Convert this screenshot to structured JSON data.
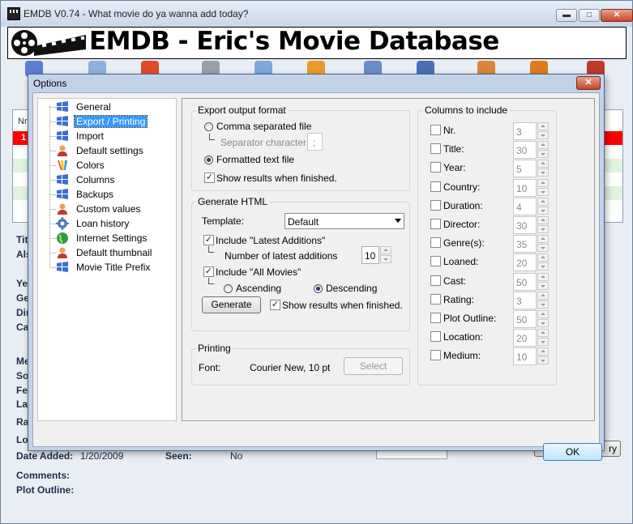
{
  "main_window": {
    "title": "EMDB V0.74 - What movie do ya wanna add today?",
    "banner_title": "EMDB - Eric's Movie Database",
    "controls": {
      "minimize": "▬",
      "maximize": "□",
      "close": "✕"
    }
  },
  "background_details": {
    "list_header_fragment": "Nr",
    "row_fragment": "1",
    "labels": [
      "Tit",
      "Als",
      "Ye",
      "Ge",
      "Dir",
      "Ca",
      "Me",
      "So",
      "Fe",
      "La",
      "Ra",
      "Lo"
    ],
    "date_added_label": "Date Added:",
    "date_added_value": "1/20/2009",
    "seen_label": "Seen:",
    "seen_value": "No",
    "comments_label": "Comments:",
    "plot_outline_label": "Plot Outline:",
    "button_fragment": "ry"
  },
  "dialog": {
    "title": "Options",
    "close": "✕",
    "ok_label": "OK",
    "tree": [
      {
        "label": "General",
        "icon": "windows-flag-icon"
      },
      {
        "label": "Export / Printing",
        "icon": "windows-flag-icon",
        "selected": true
      },
      {
        "label": "Import",
        "icon": "windows-flag-icon"
      },
      {
        "label": "Default settings",
        "icon": "user-icon"
      },
      {
        "label": "Colors",
        "icon": "palette-icon"
      },
      {
        "label": "Columns",
        "icon": "windows-flag-icon"
      },
      {
        "label": "Backups",
        "icon": "windows-flag-icon"
      },
      {
        "label": "Custom values",
        "icon": "user-icon"
      },
      {
        "label": "Loan history",
        "icon": "gear-icon"
      },
      {
        "label": "Internet Settings",
        "icon": "globe-icon"
      },
      {
        "label": "Default thumbnail",
        "icon": "user-icon"
      },
      {
        "label": "Movie Title Prefix",
        "icon": "windows-flag-icon"
      }
    ],
    "export": {
      "title": "Export output format",
      "csv_label": "Comma separated file",
      "csv_selected": false,
      "separator_label": "Separator character:",
      "separator_value": ";",
      "formatted_label": "Formatted text file",
      "formatted_selected": true,
      "show_results_label": "Show results when finished.",
      "show_results_checked": true
    },
    "html": {
      "title": "Generate HTML",
      "template_label": "Template:",
      "template_value": "Default",
      "latest_label": "Include \"Latest Additions\"",
      "latest_checked": true,
      "number_label": "Number of latest additions",
      "number_value": "10",
      "all_label": "Include \"All Movies\"",
      "all_checked": true,
      "ascending_label": "Ascending",
      "ascending_selected": false,
      "descending_label": "Descending",
      "descending_selected": true,
      "generate_label": "Generate",
      "show_results_label": "Show results when finished.",
      "show_results_checked": true
    },
    "printing": {
      "title": "Printing",
      "font_label": "Font:",
      "font_value": "Courier New, 10 pt",
      "select_label": "Select"
    },
    "columns": {
      "title": "Columns to include",
      "items": [
        {
          "label": "Nr.",
          "value": "3",
          "checked": false
        },
        {
          "label": "Title:",
          "value": "30",
          "checked": false
        },
        {
          "label": "Year:",
          "value": "5",
          "checked": false
        },
        {
          "label": "Country:",
          "value": "10",
          "checked": false
        },
        {
          "label": "Duration:",
          "value": "4",
          "checked": false
        },
        {
          "label": "Director:",
          "value": "30",
          "checked": false
        },
        {
          "label": "Genre(s):",
          "value": "35",
          "checked": false
        },
        {
          "label": "Loaned:",
          "value": "20",
          "checked": false
        },
        {
          "label": "Cast:",
          "value": "50",
          "checked": false
        },
        {
          "label": "Rating:",
          "value": "3",
          "checked": false
        },
        {
          "label": "Plot Outline:",
          "value": "50",
          "checked": false
        },
        {
          "label": "Location:",
          "value": "20",
          "checked": false
        },
        {
          "label": "Medium:",
          "value": "10",
          "checked": false
        }
      ]
    }
  },
  "colors": {
    "selection": "#3399ff",
    "list_highlight": "#ff0000",
    "list_alt": "#d9f2d9"
  }
}
